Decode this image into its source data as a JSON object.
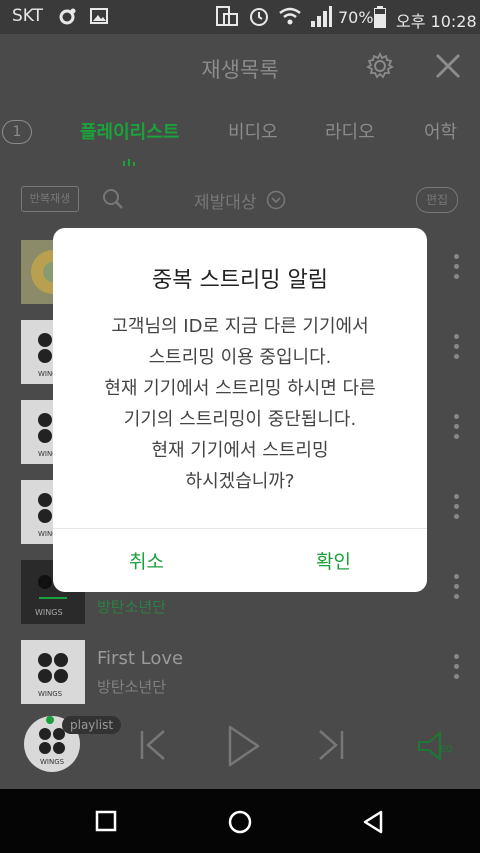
{
  "status_bar": {
    "carrier": "SKT",
    "battery": "70%",
    "time": "오후 10:28"
  },
  "header": {
    "title": "재생목록"
  },
  "tabs": {
    "badge": "1",
    "items": [
      "플레이리스트",
      "비디오",
      "라디오",
      "어학"
    ],
    "active_index": 0
  },
  "toolbar": {
    "repeat_label": "반복재생",
    "filter_label": "제발대상",
    "edit_label": "편집"
  },
  "list": [
    {
      "title": "",
      "artist": ""
    },
    {
      "title": "",
      "artist": ""
    },
    {
      "title": "",
      "artist": ""
    },
    {
      "title": "",
      "artist": ""
    },
    {
      "title": "",
      "artist": "방탄소년단"
    },
    {
      "title": "First Love",
      "artist": "방탄소년단"
    }
  ],
  "player": {
    "playlist_label": "playlist",
    "album_label": "WINGS"
  },
  "dialog": {
    "title": "중복 스트리밍 알림",
    "lines": [
      "고객님의 ID로 지금 다른 기기에서",
      "스트리밍 이용 중입니다.",
      "현재 기기에서 스트리밍 하시면 다른",
      "기기의 스트리밍이 중단됩니다.",
      "현재 기기에서 스트리밍",
      "하시겠습니까?"
    ],
    "cancel_label": "취소",
    "confirm_label": "확인"
  },
  "colors": {
    "accent": "#1aa23a",
    "overlay": "#4a4a4a",
    "navbar": "#050505"
  }
}
